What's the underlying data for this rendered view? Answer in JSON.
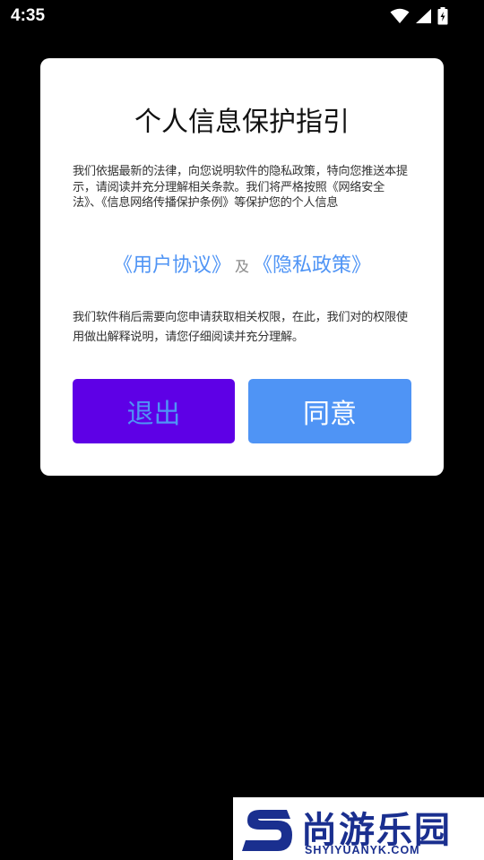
{
  "status_bar": {
    "time": "4:35",
    "icons": [
      "wifi-icon",
      "signal-icon",
      "battery-charging-icon"
    ]
  },
  "dialog": {
    "title": "个人信息保护指引",
    "paragraph1": "我们依据最新的法律，向您说明软件的隐私政策，特向您推送本提示，请阅读并充分理解相关条款。我们将严格按照《网络安全法》、《信息网络传播保护条例》等保护您的个人信息",
    "link_user_agreement": "《用户协议》",
    "link_separator": "及",
    "link_privacy_policy": "《隐私政策》",
    "paragraph2": "我们软件稍后需要向您申请获取相关权限，在此，我们对的权限使用做出解释说明，请您仔细阅读并充分理解。",
    "exit_label": "退出",
    "agree_label": "同意"
  },
  "watermark": {
    "name_cn": "尚游乐园",
    "domain": "SHYIYUANYK.COM"
  },
  "colors": {
    "accent_blue": "#4f94f5",
    "exit_purple": "#5e00e6",
    "watermark_navy": "#1a2f8f"
  }
}
